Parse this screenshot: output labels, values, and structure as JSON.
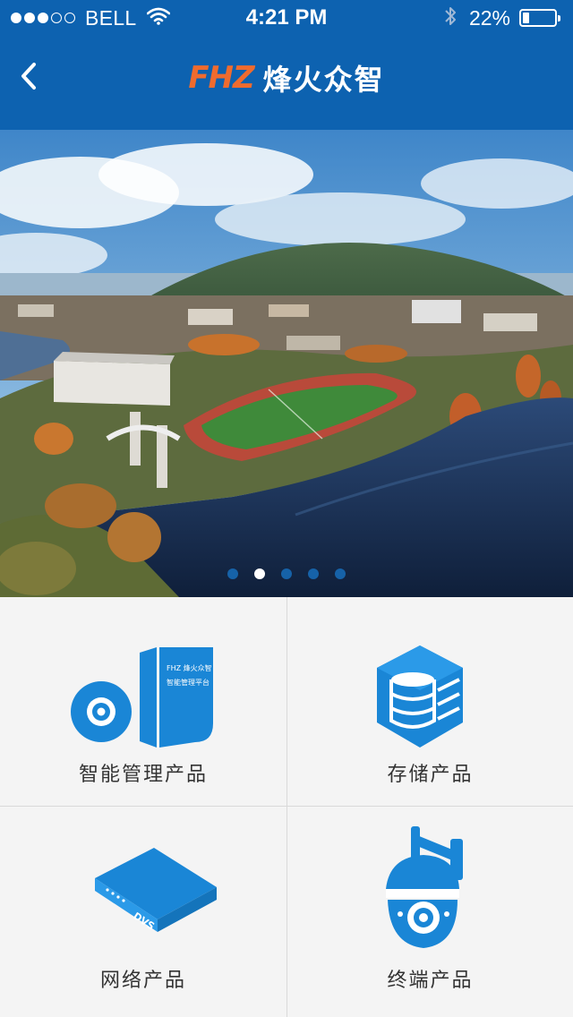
{
  "status_bar": {
    "carrier": "BELL",
    "signal_bars": 3,
    "signal_max": 5,
    "time": "4:21 PM",
    "battery_percent": "22%",
    "battery_level": 0.22
  },
  "nav": {
    "back_icon": "chevron-left-icon",
    "logo_mark": "FHZ",
    "logo_text": "烽火众智"
  },
  "banner": {
    "slide_count": 5,
    "active_slide": 2
  },
  "products": [
    {
      "label": "智能管理产品",
      "icon": "software-box-disc-icon",
      "box_text_1": "FHZ 烽火众智",
      "box_text_2": "智能管理平台"
    },
    {
      "label": "存储产品",
      "icon": "database-cube-icon"
    },
    {
      "label": "网络产品",
      "icon": "dvs-device-icon",
      "device_text": "DVS"
    },
    {
      "label": "终端产品",
      "icon": "dome-camera-icon"
    }
  ],
  "colors": {
    "brand_blue": "#0d62b0",
    "icon_blue": "#1a86d6",
    "logo_orange": "#ef6b2e"
  }
}
